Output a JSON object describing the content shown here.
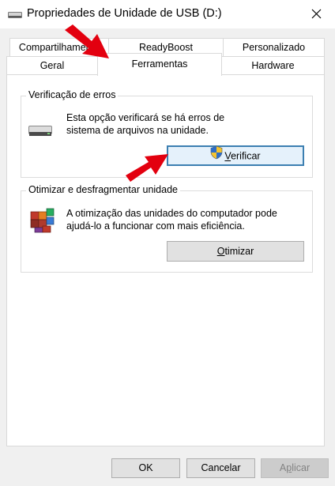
{
  "window": {
    "title": "Propriedades de Unidade de USB (D:)"
  },
  "tabs": {
    "row_back": [
      {
        "label": "Compartilhamento"
      },
      {
        "label": "ReadyBoost"
      },
      {
        "label": "Personalizado"
      }
    ],
    "row_front": [
      {
        "label": "Geral"
      },
      {
        "label": "Ferramentas",
        "selected": true
      },
      {
        "label": "Hardware"
      }
    ]
  },
  "error_check": {
    "group_title": "Verificação de erros",
    "description": "Esta opção verificará se há erros de sistema de arquivos na unidade.",
    "button_label": "Verificar"
  },
  "optimize": {
    "group_title": "Otimizar e desfragmentar unidade",
    "description": "A otimização das unidades do computador pode ajudá-lo a funcionar com mais eficiência.",
    "button_label": "Otimizar"
  },
  "footer": {
    "ok_label": "OK",
    "cancel_label": "Cancelar",
    "apply_label": "Aplicar"
  },
  "colors": {
    "annotation_arrow": "#e3000f",
    "focus_border": "#3c7fb1"
  }
}
